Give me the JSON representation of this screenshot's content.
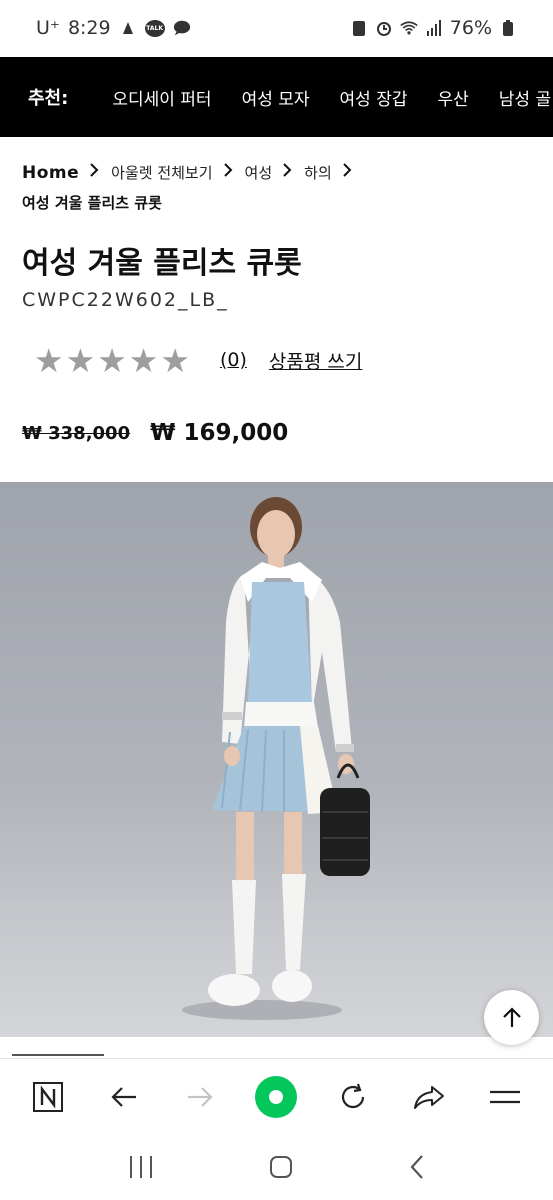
{
  "status_bar": {
    "carrier": "U⁺",
    "time": "8:29",
    "talk_badge": "TALK",
    "battery": "76%"
  },
  "recommend_nav": {
    "label": "추천:",
    "items": [
      "오디세이 퍼터",
      "여성 모자",
      "여성 장갑",
      "우산",
      "남성 골"
    ]
  },
  "breadcrumb": {
    "home": "Home",
    "items": [
      "아울렛 전체보기",
      "여성",
      "하의"
    ],
    "current": "여성 겨울 플리츠 큐롯"
  },
  "product": {
    "title": "여성 겨울 플리츠 큐롯",
    "code": "CWPC22W602_LB_",
    "rating": 0,
    "review_count": "(0)",
    "write_review": "상품평 쓰기",
    "original_price": "₩ 338,000",
    "sale_price": "₩ 169,000"
  },
  "icons": {
    "back": "arrow-left-icon",
    "forward": "arrow-right-icon",
    "home": "green-dot-icon",
    "refresh": "refresh-icon",
    "share": "share-icon",
    "menu": "hamburger-icon",
    "scroll_top": "arrow-up-icon",
    "naver": "N"
  },
  "colors": {
    "nav_bg": "#000000",
    "star": "#9e9e9e",
    "naver_green": "#03c75a",
    "sweater_blue": "#a9c7de"
  }
}
